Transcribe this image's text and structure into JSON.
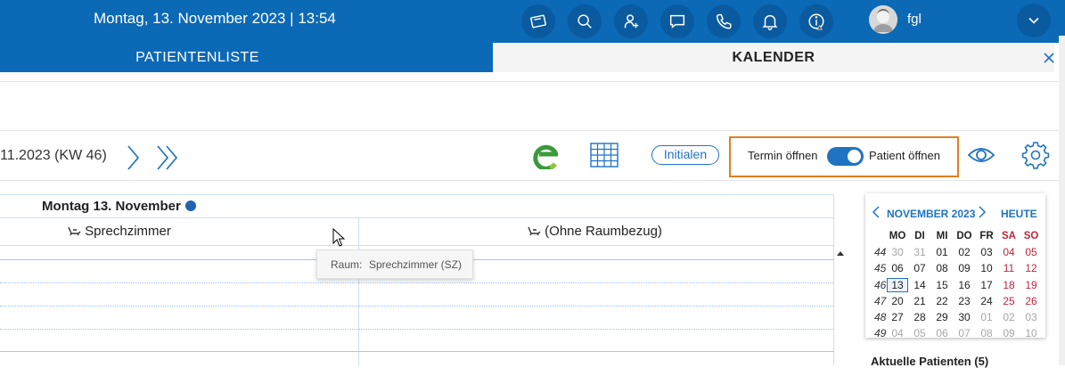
{
  "topbar": {
    "datetime": "Montag, 13. November 2023 | 13:54",
    "icons": [
      "card-icon",
      "search-icon",
      "add-user-icon",
      "message-icon",
      "phone-icon",
      "bell-icon",
      "info-warning-icon"
    ],
    "user_name": "fgl",
    "background": "#0b69b6"
  },
  "tabs": {
    "left": "PATIENTENLISTE",
    "right": "KALENDER"
  },
  "toolbar": {
    "week_label": "11.2023 (KW 46)",
    "initialen": "Initialen",
    "toggle_left": "Termin öffnen",
    "toggle_right": "Patient öffnen",
    "toggle_on": true,
    "highlight_color": "#e07f1f"
  },
  "calendar": {
    "day_title": "Montag 13. November",
    "rooms": [
      "Sprechzimmer",
      "(Ohne Raumbezug)"
    ]
  },
  "tooltip": {
    "key": "Raum:",
    "value": "Sprechzimmer (SZ)"
  },
  "mini_calendar": {
    "month": "NOVEMBER 2023",
    "today_label": "HEUTE",
    "weekdays": [
      "MO",
      "DI",
      "MI",
      "DO",
      "FR",
      "SA",
      "SO"
    ],
    "weeks": [
      {
        "kw": "44",
        "days": [
          "30",
          "31",
          "01",
          "02",
          "03",
          "04",
          "05"
        ]
      },
      {
        "kw": "45",
        "days": [
          "06",
          "07",
          "08",
          "09",
          "10",
          "11",
          "12"
        ]
      },
      {
        "kw": "46",
        "days": [
          "13",
          "14",
          "15",
          "16",
          "17",
          "18",
          "19"
        ]
      },
      {
        "kw": "47",
        "days": [
          "20",
          "21",
          "22",
          "23",
          "24",
          "25",
          "26"
        ]
      },
      {
        "kw": "48",
        "days": [
          "27",
          "28",
          "29",
          "30",
          "01",
          "02",
          "03"
        ]
      },
      {
        "kw": "49",
        "days": [
          "04",
          "05",
          "06",
          "07",
          "08",
          "09",
          "10"
        ]
      }
    ],
    "selected": "13"
  },
  "aktuelle_patienten": "Aktuelle Patienten (5)"
}
